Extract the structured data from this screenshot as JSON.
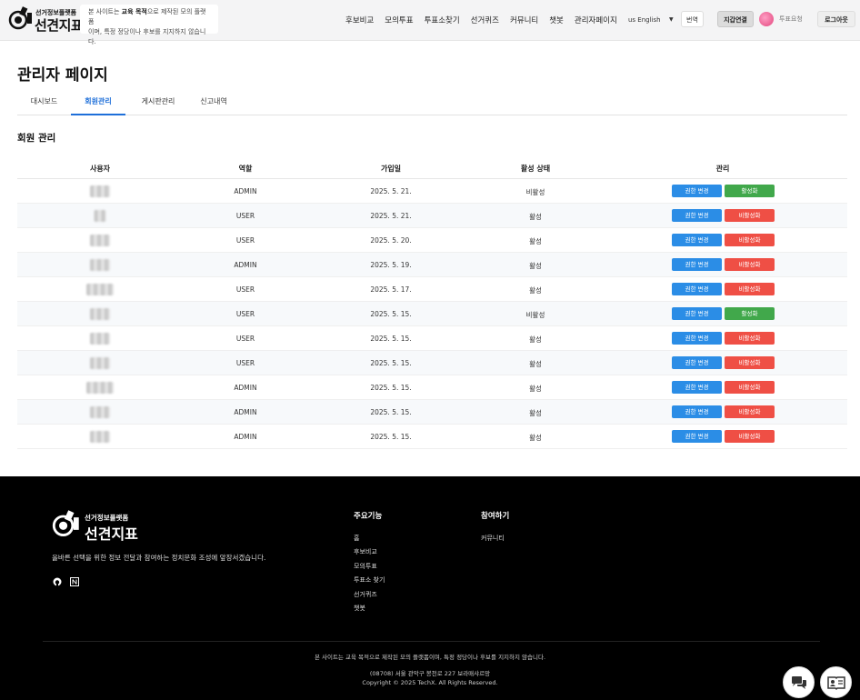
{
  "header": {
    "logo_small": "선거정보플랫폼",
    "logo_big": "선견지표",
    "notice_pre": "본 사이트는 ",
    "notice_bold": "교육 목적",
    "notice_post": "으로 제작된 모의 플랫폼",
    "notice_line2": "이며, 특정 정당이나 후보를 지지하지 않습니다.",
    "nav": [
      "후보비교",
      "모의투표",
      "투표소찾기",
      "선거퀴즈",
      "커뮤니티",
      "챗봇",
      "관리자페이지"
    ],
    "language": "us English",
    "translate_label": "번역",
    "wallet_label": "지갑연결",
    "vote_request_label": "투표요청",
    "logout_label": "로그아웃"
  },
  "page": {
    "title": "관리자 페이지",
    "tabs": [
      "대시보드",
      "회원관리",
      "게시판관리",
      "신고내역"
    ],
    "active_tab": "회원관리",
    "section_title": "회원 관리"
  },
  "table": {
    "headers": [
      "사용자",
      "역할",
      "가입일",
      "활성 상태",
      "관리"
    ],
    "role_change_label": "권한 변경",
    "deactivate_label": "비활성화",
    "activate_label": "활성화",
    "rows": [
      {
        "role": "ADMIN",
        "joined": "2025. 5. 21.",
        "status": "비활성",
        "toggle": "활성화"
      },
      {
        "role": "USER",
        "joined": "2025. 5. 21.",
        "status": "활성",
        "toggle": "비활성화"
      },
      {
        "role": "USER",
        "joined": "2025. 5. 20.",
        "status": "활성",
        "toggle": "비활성화"
      },
      {
        "role": "ADMIN",
        "joined": "2025. 5. 19.",
        "status": "활성",
        "toggle": "비활성화"
      },
      {
        "role": "USER",
        "joined": "2025. 5. 17.",
        "status": "활성",
        "toggle": "비활성화"
      },
      {
        "role": "USER",
        "joined": "2025. 5. 15.",
        "status": "비활성",
        "toggle": "활성화"
      },
      {
        "role": "USER",
        "joined": "2025. 5. 15.",
        "status": "활성",
        "toggle": "비활성화"
      },
      {
        "role": "USER",
        "joined": "2025. 5. 15.",
        "status": "활성",
        "toggle": "비활성화"
      },
      {
        "role": "ADMIN",
        "joined": "2025. 5. 15.",
        "status": "활성",
        "toggle": "비활성화"
      },
      {
        "role": "ADMIN",
        "joined": "2025. 5. 15.",
        "status": "활성",
        "toggle": "비활성화"
      },
      {
        "role": "ADMIN",
        "joined": "2025. 5. 15.",
        "status": "활성",
        "toggle": "비활성화"
      }
    ]
  },
  "footer": {
    "logo_small": "선거정보플랫폼",
    "logo_big": "선견지표",
    "tagline": "올바른 선택을 위한 정보 전달과 참여하는 정치문화 조성에 앞장서겠습니다.",
    "col1_title": "주요기능",
    "col1_links": [
      "홈",
      "후보비교",
      "모의투표",
      "투표소 찾기",
      "선거퀴즈",
      "챗봇"
    ],
    "col2_title": "참여하기",
    "col2_links": [
      "커뮤니티"
    ],
    "disclaimer": "본 사이트는 교육 목적으로 제작된 모의 플랫폼이며, 특정 정당이나 후보를 지지하지 않습니다.",
    "address": "(08708) 서울 관악구 봉천로 227 보라매샤르망",
    "copyright": "Copyright © 2025 TechX. All Rights Reserved."
  },
  "colors": {
    "accent_blue": "#1e6fd9",
    "role_button": "#2b8de6",
    "deactivate_button": "#ef4f45",
    "activate_button": "#41a84b",
    "footer_bg": "#000000"
  }
}
